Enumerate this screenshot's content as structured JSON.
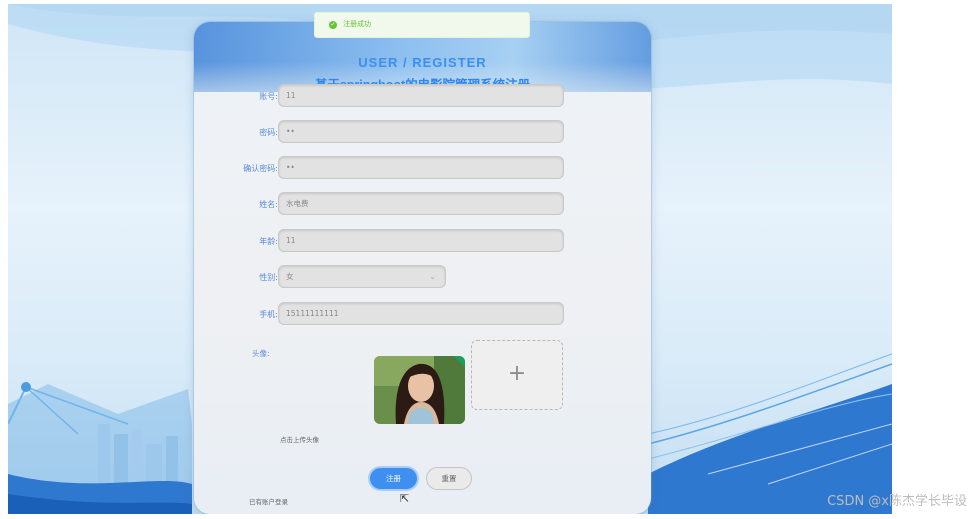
{
  "toast": {
    "message": "注册成功"
  },
  "header": {
    "subtitle": "USER / REGISTER",
    "title": "基于springboot的电影院管理系统注册"
  },
  "form": {
    "account": {
      "label": "账号:",
      "value": "11"
    },
    "password": {
      "label": "密码:",
      "value": "••"
    },
    "confirm_password": {
      "label": "确认密码:",
      "value": "••"
    },
    "name": {
      "label": "姓名:",
      "value": "水电费"
    },
    "age": {
      "label": "年龄:",
      "value": "11"
    },
    "gender": {
      "label": "性别:",
      "value": "女"
    },
    "phone": {
      "label": "手机:",
      "value": "15111111111"
    },
    "avatar": {
      "label": "头像:",
      "add_symbol": "+"
    },
    "hint": "点击上传头像"
  },
  "buttons": {
    "register": "注册",
    "reset": "重置"
  },
  "links": {
    "login": "已有账户登录"
  },
  "watermark": "CSDN @x陈杰学长毕设",
  "colors": {
    "accent": "#3e8ff0",
    "success": "#67c23a"
  }
}
